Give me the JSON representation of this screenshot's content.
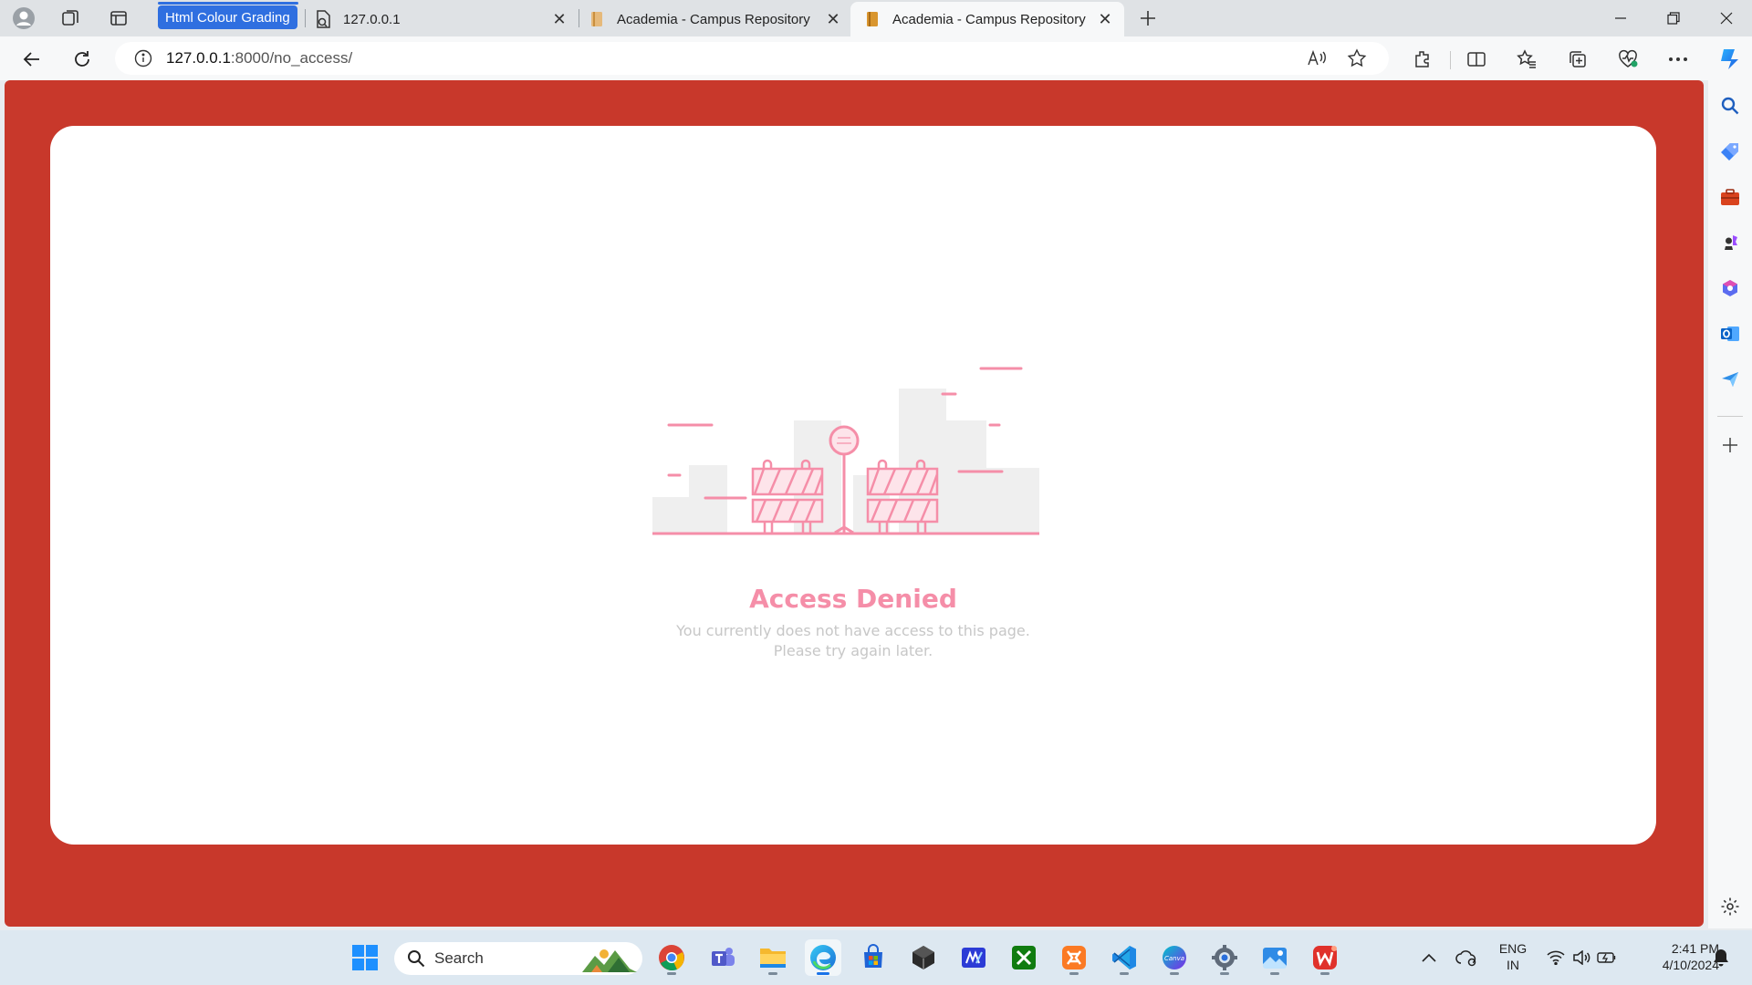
{
  "browser": {
    "tab_group_label": "Html Colour Grading",
    "tabs": [
      {
        "title": "127.0.0.1"
      },
      {
        "title": "Academia - Campus Repository"
      },
      {
        "title": "Academia - Campus Repository"
      }
    ],
    "address": {
      "host": "127.0.0.1",
      "rest": ":8000/no_access/"
    }
  },
  "page": {
    "title": "Access Denied",
    "message_line1": "You currently does not have access to this page.",
    "message_line2": "Please try again later.",
    "colors": {
      "background": "#c8382b",
      "card": "#ffffff",
      "accent": "#f58ea8"
    }
  },
  "taskbar": {
    "search_label": "Search",
    "lang_line1": "ENG",
    "lang_line2": "IN",
    "time": "2:41 PM",
    "date": "4/10/2024"
  }
}
